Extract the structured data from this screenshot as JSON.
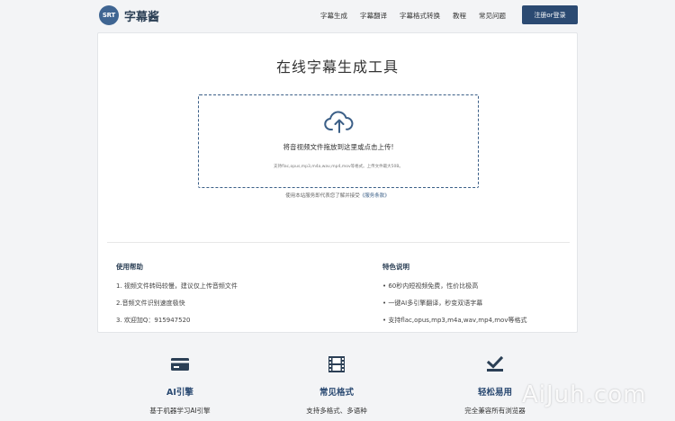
{
  "brand": {
    "badge": "SRT",
    "name": "字幕酱",
    "color": "#3f6592"
  },
  "nav": {
    "links": [
      "字幕生成",
      "字幕翻译",
      "字幕格式转换",
      "教程",
      "常见问题"
    ],
    "login_label": "注册or登录"
  },
  "main": {
    "title": "在线字幕生成工具",
    "upload": {
      "icon": "cloud-upload-icon",
      "prompt": "将音视频文件拖放到这里或点击上传!",
      "hint": "支持flac,opus,mp3,m4a,wav,mp4,mov等格式。上传文件最大50B。"
    },
    "terms_text": "使用本站服务即代表您了解并接受",
    "terms_link": "《服务条款》"
  },
  "help": {
    "title": "使用帮助",
    "items": [
      "1. 视频文件转码较慢，建议仅上传音频文件",
      "2.音频文件识别速度极快",
      "3. 欢迎加Q：915947520"
    ]
  },
  "features_list": {
    "title": "特色说明",
    "items": [
      "• 60秒内短视频免费，性价比极高",
      "• 一键AI多引擎翻译，秒变双语字幕",
      "• 支持flac,opus,mp3,m4a,wav,mp4,mov等格式"
    ]
  },
  "features": [
    {
      "icon": "credit-card-icon",
      "title": "AI引擎",
      "desc": "基于机器学习AI引擎"
    },
    {
      "icon": "film-icon",
      "title": "常见格式",
      "desc": "支持多格式、多语种"
    },
    {
      "icon": "checkbox-icon",
      "title": "轻松易用",
      "desc": "完全兼容所有浏览器"
    }
  ],
  "watermark": "AiJuh.com",
  "colors": {
    "primary": "#2b4a72",
    "accent": "#3b5f87"
  }
}
